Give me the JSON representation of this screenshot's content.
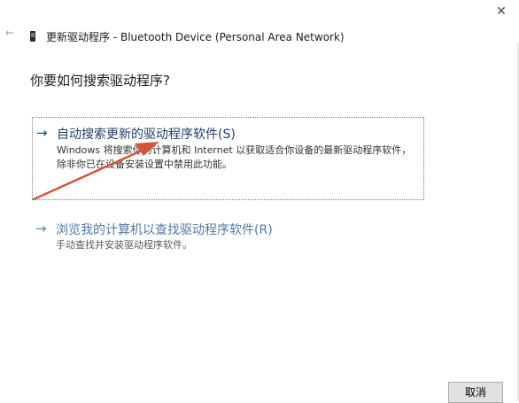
{
  "window": {
    "title": "更新驱动程序 - Bluetooth Device (Personal Area Network)"
  },
  "icons": {
    "back": "back-arrow-icon",
    "device": "device-icon",
    "close": "close-icon"
  },
  "main": {
    "question": "你要如何搜索驱动程序?",
    "options": [
      {
        "arrow": "→",
        "title": "自动搜索更新的驱动程序软件(S)",
        "description": "Windows 将搜索你的计算机和 Internet 以获取适合你设备的最新驱动程序软件，除非你已在设备安装设置中禁用此功能。"
      },
      {
        "arrow": "→",
        "title": "浏览我的计算机以查找驱动程序软件(R)",
        "description": "手动查找并安装驱动程序软件。"
      }
    ]
  },
  "footer": {
    "cancel_label": "取消"
  },
  "colors": {
    "link": "#1d3f6b",
    "link_hover_dim": "#4f7aa8",
    "annotation_arrow": "#d4553a"
  }
}
